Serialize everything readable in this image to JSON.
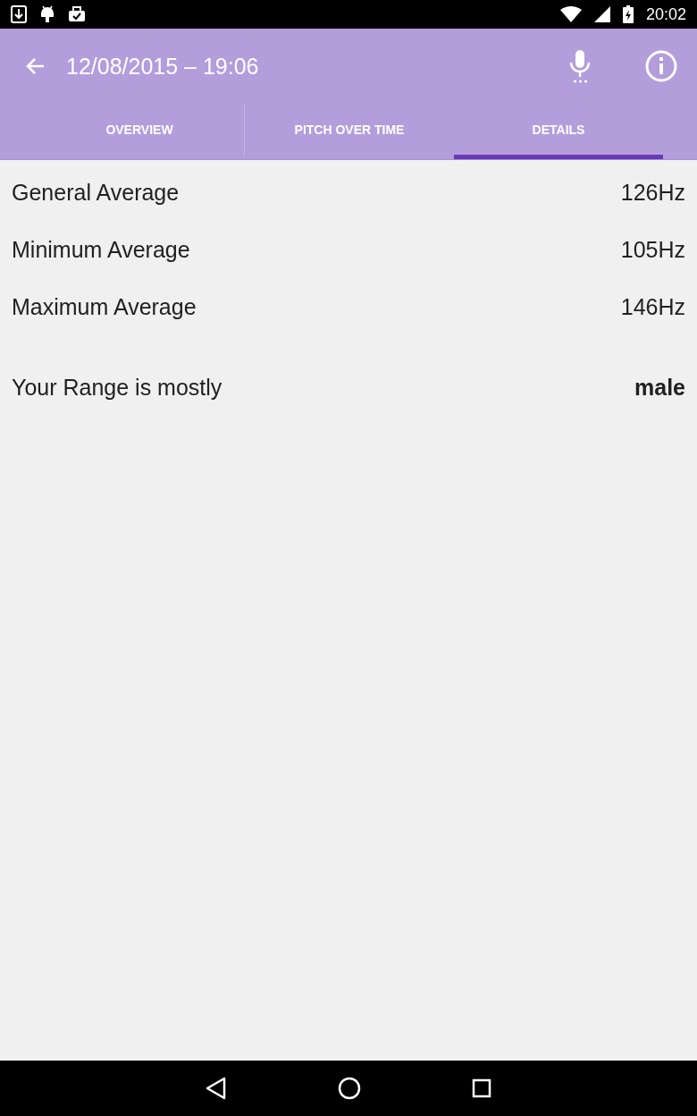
{
  "status_bar": {
    "time": "20:02"
  },
  "app_bar": {
    "title": "12/08/2015 – 19:06"
  },
  "tabs": [
    {
      "label": "OVERVIEW",
      "selected": false
    },
    {
      "label": "PITCH OVER TIME",
      "selected": false
    },
    {
      "label": "DETAILS",
      "selected": true
    }
  ],
  "rows": [
    {
      "kind": "stat",
      "label": "General Average",
      "value": "126Hz"
    },
    {
      "kind": "stat",
      "label": "Minimum Average",
      "value": "105Hz"
    },
    {
      "kind": "stat",
      "label": "Maximum Average",
      "value": "146Hz"
    },
    {
      "kind": "summary",
      "label": "Your Range is mostly",
      "value": "male"
    }
  ]
}
